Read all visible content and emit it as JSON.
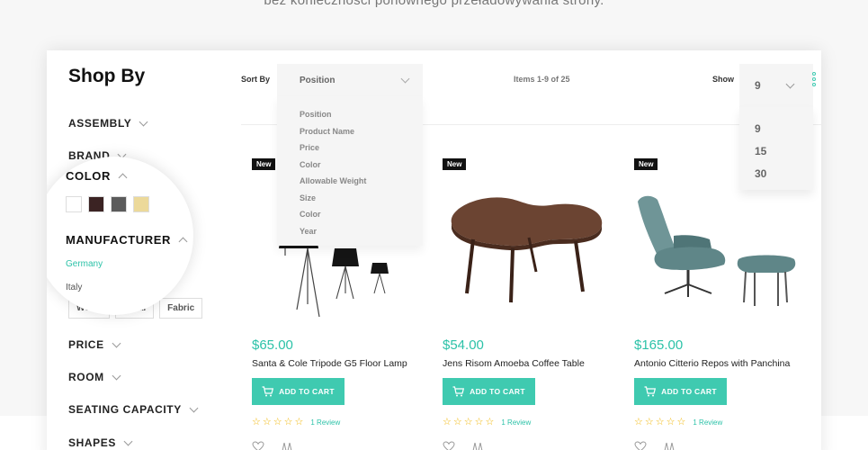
{
  "caption": "bez konieczności ponownego przeładowywania strony.",
  "sidebar": {
    "title": "Shop By",
    "filters": {
      "assembly": "ASSEMBLY",
      "brand": "BRAND",
      "price": "PRICE",
      "room": "ROOM",
      "seating": "SEATING CAPACITY",
      "shapes": "SHAPES"
    },
    "material_tags": [
      "Wood",
      "Metal",
      "Fabric"
    ],
    "magnifier": {
      "color_title": "COLOR",
      "swatch_colors": [
        "#ffffff",
        "#3b2323",
        "#5b5b5b",
        "#ecd99a"
      ],
      "manufacturer_title": "MANUFACTURER",
      "manufacturers": [
        "Germany",
        "Italy"
      ],
      "active_color": "#2cc2a8"
    }
  },
  "toolbar": {
    "sort_label": "Sort By",
    "sort_selected": "Position",
    "sort_options": [
      "Position",
      "Product Name",
      "Price",
      "Color",
      "Allowable Weight",
      "Size",
      "Color",
      "Year"
    ],
    "items_count": "Items 1-9 of 25",
    "show_label": "Show",
    "show_selected": "9",
    "show_options": [
      "9",
      "15",
      "30"
    ]
  },
  "products": [
    {
      "badge": "New",
      "price": "$65.00",
      "name": "Santa & Cole Tripode G5 Floor Lamp",
      "cart_label": "ADD TO CART",
      "review": "1 Review",
      "rating": 0
    },
    {
      "badge": "New",
      "price": "$54.00",
      "name": "Jens Risom Amoeba Coffee Table",
      "cart_label": "ADD TO CART",
      "review": "1 Review",
      "rating": 0
    },
    {
      "badge": "New",
      "price": "$165.00",
      "name": "Antonio Citterio Repos with Panchina",
      "cart_label": "ADD TO CART",
      "review": "1 Review",
      "rating": 0
    }
  ],
  "colors": {
    "accent": "#3fcab0",
    "accent_text": "#2cc2a8",
    "badge_bg": "#111111"
  }
}
